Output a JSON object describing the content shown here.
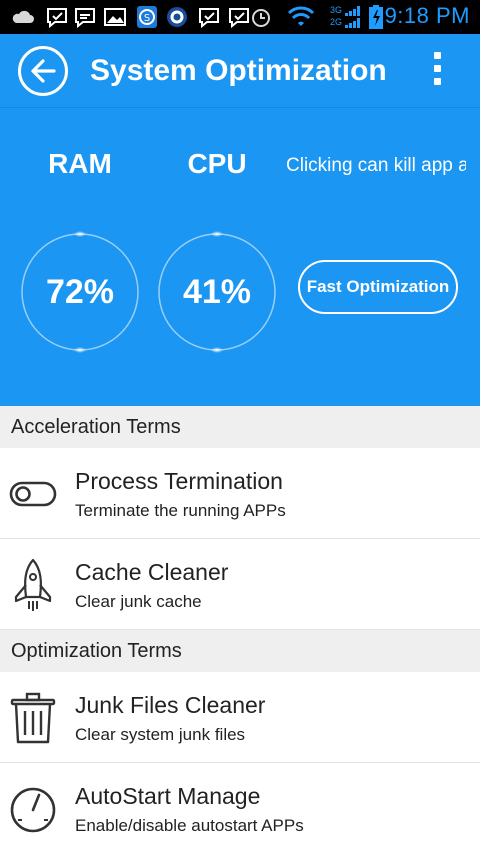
{
  "status_bar": {
    "time": "9:18 PM",
    "network_labels": [
      "3G",
      "2G"
    ],
    "icons": [
      "cloud-icon",
      "message-icon",
      "message-icon",
      "image-icon",
      "s-app-icon",
      "q-app-icon",
      "message-icon",
      "message-icon",
      "alarm-icon",
      "wifi-icon",
      "signal-icon",
      "battery-charging-icon"
    ]
  },
  "app_bar": {
    "title": "System Optimization",
    "back_icon": "back-arrow-icon",
    "menu_icon": "overflow-menu-icon"
  },
  "hero": {
    "ram_label": "RAM",
    "cpu_label": "CPU",
    "hint_text": "Clicking can kill app a",
    "ram_value": "72%",
    "cpu_value": "41%",
    "fast_button_label": "Fast Optimization"
  },
  "sections": [
    {
      "title": "Acceleration Terms",
      "items": [
        {
          "title": "Process Termination",
          "subtitle": "Terminate the running APPs",
          "icon": "toggle-switch-icon"
        },
        {
          "title": "Cache Cleaner",
          "subtitle": "Clear junk cache",
          "icon": "rocket-icon"
        }
      ]
    },
    {
      "title": "Optimization Terms",
      "items": [
        {
          "title": "Junk Files Cleaner",
          "subtitle": "Clear system junk files",
          "icon": "trash-icon"
        },
        {
          "title": "AutoStart Manage",
          "subtitle": "Enable/disable autostart APPs",
          "icon": "gauge-icon"
        }
      ]
    }
  ],
  "colors": {
    "primary": "#1b96f2",
    "section_bg": "#efefef",
    "time_color": "#1e9cff"
  }
}
